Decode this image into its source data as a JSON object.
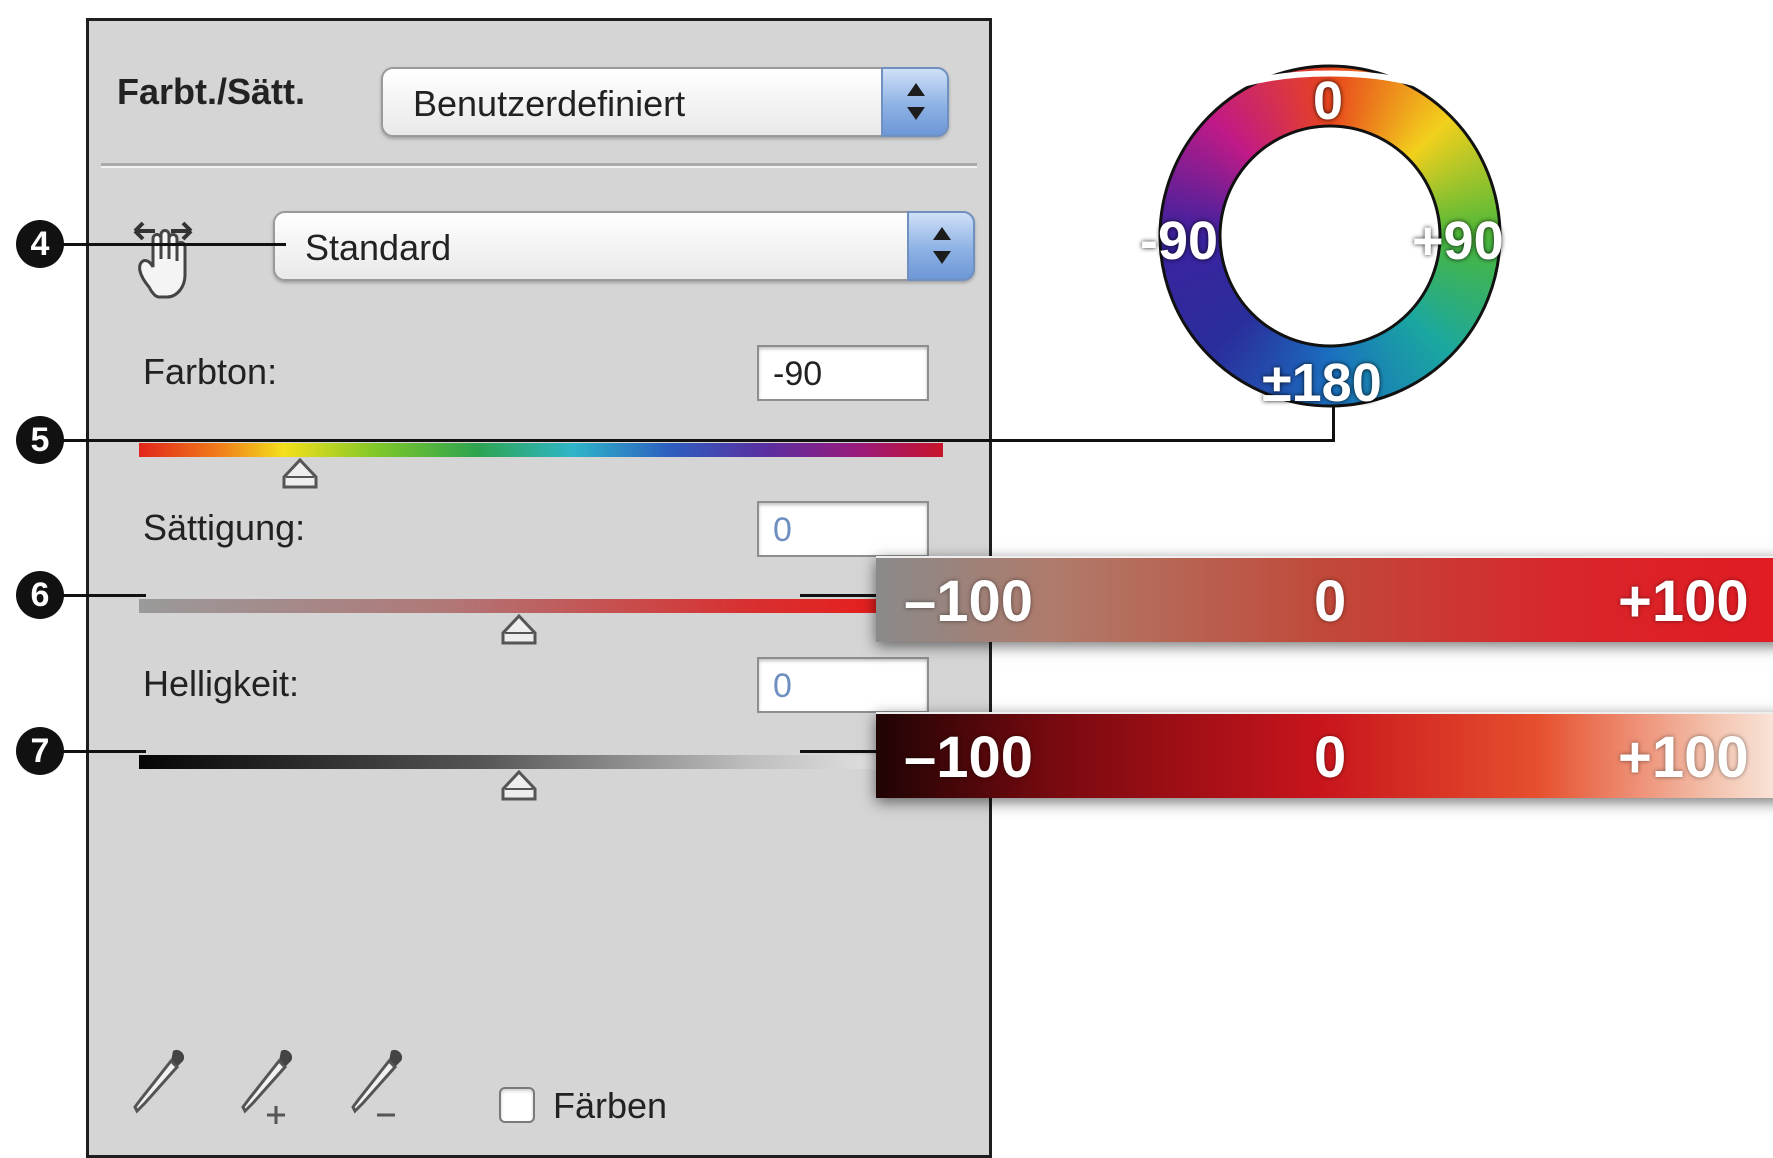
{
  "panel": {
    "title": "Farbt./Sätt.",
    "preset_value": "Benutzerdefiniert",
    "range_value": "Standard",
    "sliders": {
      "hue": {
        "label": "Farbton:",
        "value": "-90",
        "position": 0.2
      },
      "saturation": {
        "label": "Sättigung:",
        "value": "0",
        "position": 0.5
      },
      "lightness": {
        "label": "Helligkeit:",
        "value": "0",
        "position": 0.5
      }
    },
    "colorize_label": "Färben",
    "colorize_checked": false
  },
  "callouts": [
    "4",
    "5",
    "6",
    "7"
  ],
  "hue_wheel": {
    "top": "0",
    "left": "-90",
    "right": "+90",
    "bottom": "±180"
  },
  "saturation_scale": {
    "min": "–100",
    "mid": "0",
    "max": "+100"
  },
  "lightness_scale": {
    "min": "–100",
    "mid": "0",
    "max": "+100"
  },
  "icons": [
    "on-image-adjust-hand-icon",
    "eyedropper-icon",
    "eyedropper-plus-icon",
    "eyedropper-minus-icon",
    "chevron-up-down-icon"
  ]
}
